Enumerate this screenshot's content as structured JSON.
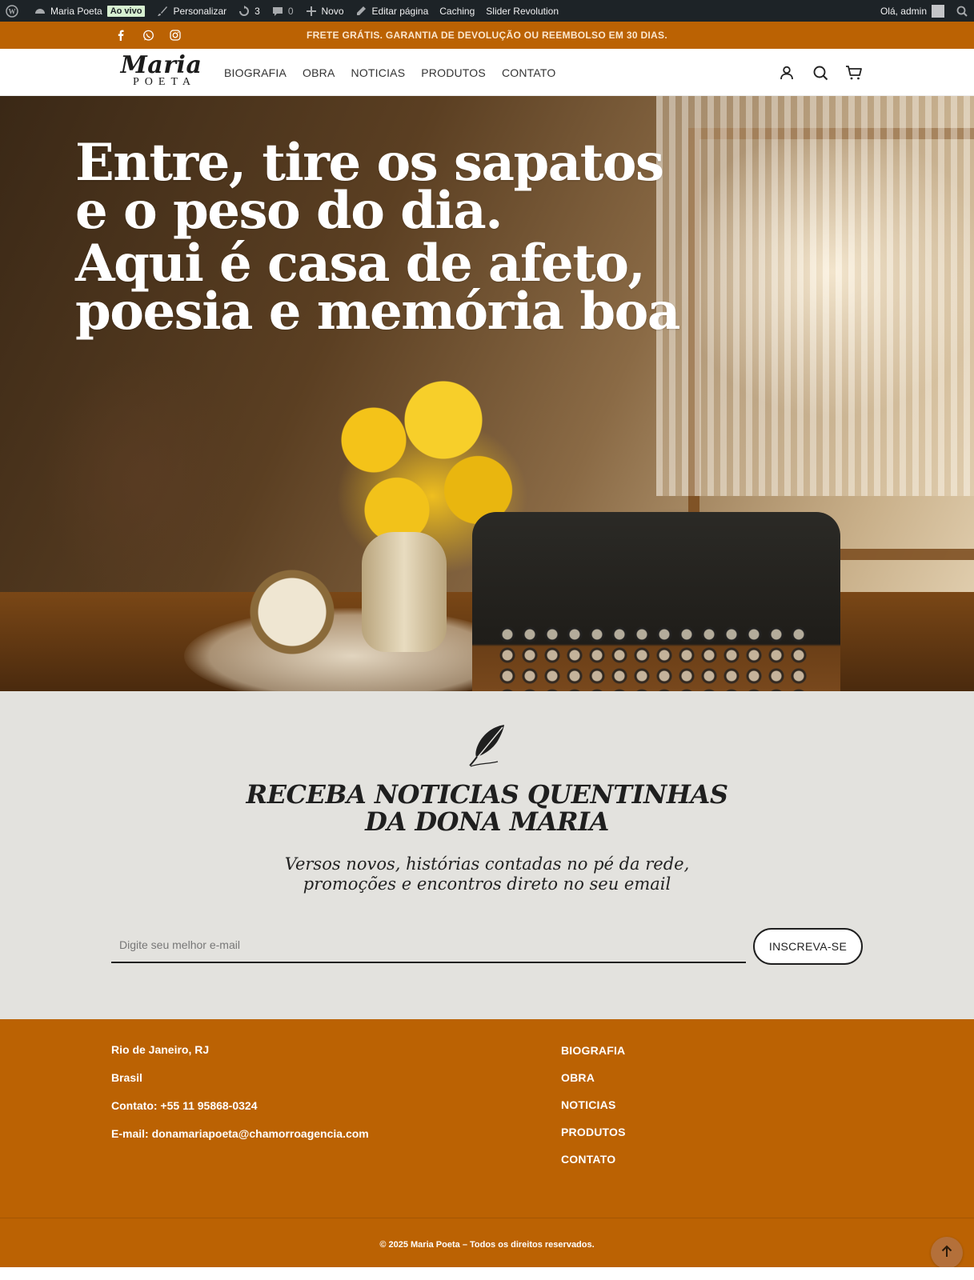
{
  "adminbar": {
    "site_name": "Maria Poeta",
    "live_badge": "Ao vivo",
    "customize": "Personalizar",
    "updates_count": "3",
    "comments_count": "0",
    "new": "Novo",
    "edit_page": "Editar página",
    "caching": "Caching",
    "slider": "Slider Revolution",
    "greeting": "Olá, admin"
  },
  "topbar": {
    "promo": "FRETE GRÁTIS. GARANTIA DE DEVOLUÇÃO OU REEMBOLSO EM 30 DIAS.",
    "socials": [
      "facebook-icon",
      "whatsapp-icon",
      "instagram-icon"
    ]
  },
  "header": {
    "logo_script": "Maria",
    "logo_sub": "POETA",
    "nav": [
      "BIOGRAFIA",
      "OBRA",
      "NOTICIAS",
      "PRODUTOS",
      "CONTATO"
    ],
    "icons": [
      "account-icon",
      "search-icon",
      "cart-icon"
    ]
  },
  "hero": {
    "lines": [
      "Entre, tire os sapatos",
      "e o peso do dia.",
      "Aqui é casa de afeto,",
      "poesia e memória boa"
    ]
  },
  "newsletter": {
    "title": "RECEBA NOTICIAS QUENTINHAS DA DONA MARIA",
    "subtitle": "Versos novos, histórias contadas no pé da rede, promoções e encontros direto no seu email",
    "email_placeholder": "Digite seu melhor e-mail",
    "button": "INSCREVA-SE"
  },
  "footer": {
    "city": "Rio de Janeiro, RJ",
    "country": "Brasil",
    "contact": "Contato: +55 11 95868-0324",
    "email": "E-mail: donamariapoeta@chamorroagencia.com",
    "links": [
      "BIOGRAFIA",
      "OBRA",
      "NOTICIAS",
      "PRODUTOS",
      "CONTATO"
    ],
    "copyright": "© 2025 Maria Poeta – Todos os direitos reservados."
  },
  "colors": {
    "brand_orange": "#bb6203",
    "admin_bar": "#1d2327",
    "newsletter_bg": "#e3e2de"
  }
}
